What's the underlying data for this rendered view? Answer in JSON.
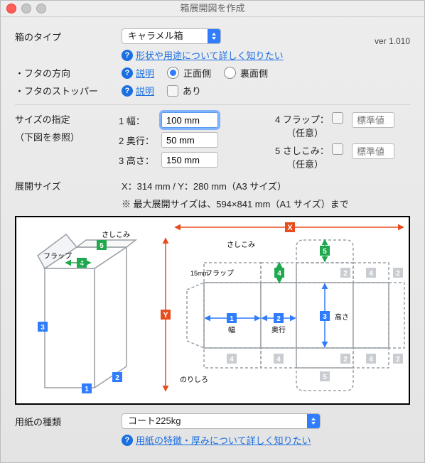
{
  "window": {
    "title": "箱展開図を作成"
  },
  "version": "ver 1.010",
  "box_type": {
    "label": "箱のタイプ",
    "value": "キャラメル箱",
    "help_link": "形状や用途について詳しく知りたい"
  },
  "lid_dir": {
    "label": "・フタの方向",
    "explain": "説明",
    "opt_front": "正面側",
    "opt_back": "裏面側"
  },
  "lid_stop": {
    "label": "・フタのストッパー",
    "explain": "説明",
    "opt_has": "あり"
  },
  "size": {
    "label": "サイズの指定",
    "sublabel": "（下図を参照）",
    "width": {
      "label": "1 幅：",
      "value": "100 mm"
    },
    "depth": {
      "label": "2 奥行：",
      "value": "50 mm"
    },
    "height": {
      "label": "3 高さ：",
      "value": "150 mm"
    },
    "flap": {
      "label": "4 フラップ：",
      "sublabel": "（任意）",
      "placeholder": "標準値"
    },
    "insert": {
      "label": "5 さしこみ：",
      "sublabel": "（任意）",
      "placeholder": "標準値"
    }
  },
  "spread": {
    "label": "展開サイズ",
    "value": "X：314 mm / Y：280 mm（A3 サイズ）",
    "note": "※ 最大展開サイズは、594×841 mm（A1 サイズ）まで"
  },
  "diagram": {
    "sashikomi": "さしこみ",
    "flap": "フラップ",
    "width": "幅",
    "depth": "奥行",
    "height": "高さ",
    "norishiro": "のりしろ",
    "fifteen": "15mm"
  },
  "paper": {
    "label": "用紙の種類",
    "value": "コート225kg",
    "help_link": "用紙の特徴・厚みについて詳しく知りたい"
  }
}
